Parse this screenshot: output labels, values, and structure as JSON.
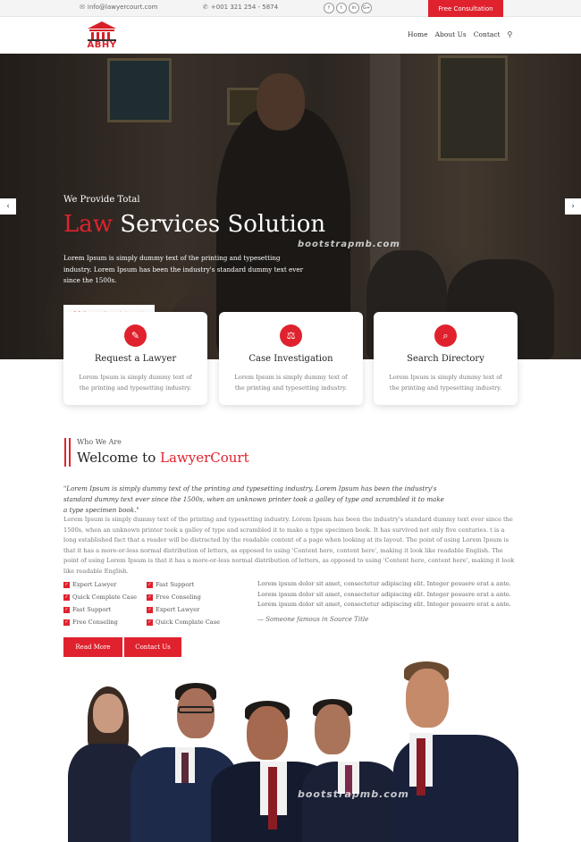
{
  "topbar": {
    "email": "info@lawyercourt.com",
    "phone": "+001 321 254 - 5874",
    "social": [
      "f",
      "t",
      "in",
      "G+"
    ],
    "cta": "Free Consultation"
  },
  "header": {
    "logo_text": "ABHY",
    "nav": [
      "Home",
      "About Us",
      "Contact"
    ]
  },
  "hero": {
    "pretitle": "We Provide Total",
    "title_accent": "Law",
    "title_rest": " Services Solution",
    "description": "Lorem Ipsum is simply dummy text of the printing and typesetting industry. Lorem Ipsum has been the industry's standard dummy text ever since the 1500s.",
    "button": "Make an Appointment",
    "prev": "‹",
    "next": "›",
    "watermark": "bootstrapmb.com"
  },
  "services": [
    {
      "title": "Request a Lawyer",
      "text": "Lorem Ipsum is simply dummy text of the printing and typesetting industry.",
      "icon": "✎"
    },
    {
      "title": "Case Investigation",
      "text": "Lorem Ipsum is simply dummy text of the printing and typesetting industry.",
      "icon": "⚖"
    },
    {
      "title": "Search Directory",
      "text": "Lorem Ipsum is simply dummy text of the printing and typesetting industry.",
      "icon": "⌕"
    }
  ],
  "welcome": {
    "label": "Who We Are",
    "title": "Welcome to ",
    "title_accent": "LawyerCourt",
    "quote": "\"Lorem Ipsum is simply dummy text of the printing and typesetting industry. Lorem Ipsum has been the industry's standard dummy text ever since the 1500s, when an unknown printer took a galley of type and scrambled it to make a type specimen book.\"",
    "paragraph": "Lorem Ipsum is simply dummy text of the printing and typesetting industry. Lorem Ipsum has been the industry's standard dummy text ever since the 1500s, when an unknown printer took a galley of type and scrambled it to make a type specimen book. It has survived not only five centuries. t is a long established fact that a reader will be distracted by the readable content of a page when looking at its layout. The point of using Lorem Ipsum is that it has a more-or-less normal distribution of letters, as opposed to using 'Content here, content here', making it look like readable English. The point of using Lorem Ipsum is that it has a more-or-less normal distribution of letters, as opposed to using 'Content here, content here', making it look like readable English.",
    "checklist_col1": [
      "Expert Lawyer",
      "Quick Complate Case",
      "Fast Support",
      "Free Conseling"
    ],
    "checklist_col2": [
      "Fast Support",
      "Free Conseling",
      "Expert Lawyer",
      "Quick Complate Case"
    ],
    "side_text": "Lorem ipsum dolor sit amet, consectetur adipiscing elit. Integer posuere erat a ante. Lorem ipsum dolor sit amet, consectetur adipiscing elit. Integer posuere erat a ante. Lorem ipsum dolor sit amet, consectetur adipiscing elit. Integer posuere erat a ante.",
    "cite_prefix": "— Someone famous in ",
    "cite_source": "Source Title",
    "read_more": "Read More",
    "contact_us": "Contact Us"
  },
  "team": {
    "watermark": "bootstrapmb.com"
  },
  "colors": {
    "accent": "#e0222e",
    "dark": "#222222"
  }
}
